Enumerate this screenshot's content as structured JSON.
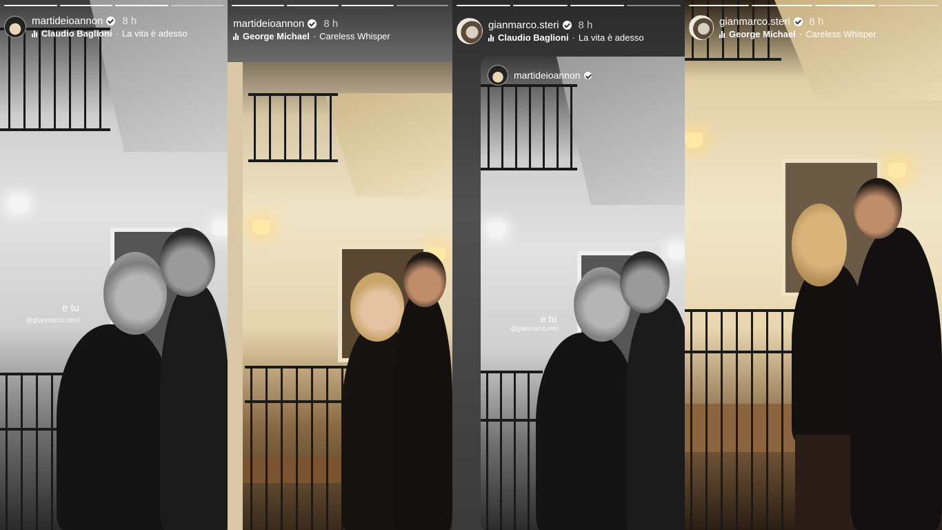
{
  "stories": [
    {
      "username": "martideioannon",
      "time": "8 h",
      "music_artist": "Claudio Baglioni",
      "music_song": "La vita è adesso",
      "caption": "e tu",
      "mention": "@gianmarco.steri"
    },
    {
      "username": "martideioannon",
      "time": "8 h",
      "music_artist": "George Michael",
      "music_song": "Careless Whisper"
    },
    {
      "username": "gianmarco.steri",
      "time": "8 h",
      "music_artist": "Claudio Baglioni",
      "music_song": "La vita è adesso",
      "reshared_username": "martideioannon",
      "caption": "e tu",
      "mention": "@gianmarco.steri"
    },
    {
      "username": "gianmarco.steri",
      "time": "8 h",
      "music_artist": "George Michael",
      "music_song": "Careless Whisper"
    }
  ],
  "separator": "·",
  "icons": {
    "verified": "verified-badge-icon",
    "music": "music-equalizer-icon"
  },
  "colors": {
    "text": "#ffffff",
    "warm_light": "#f2e6c9",
    "gray_light": "#e2e2e2"
  }
}
